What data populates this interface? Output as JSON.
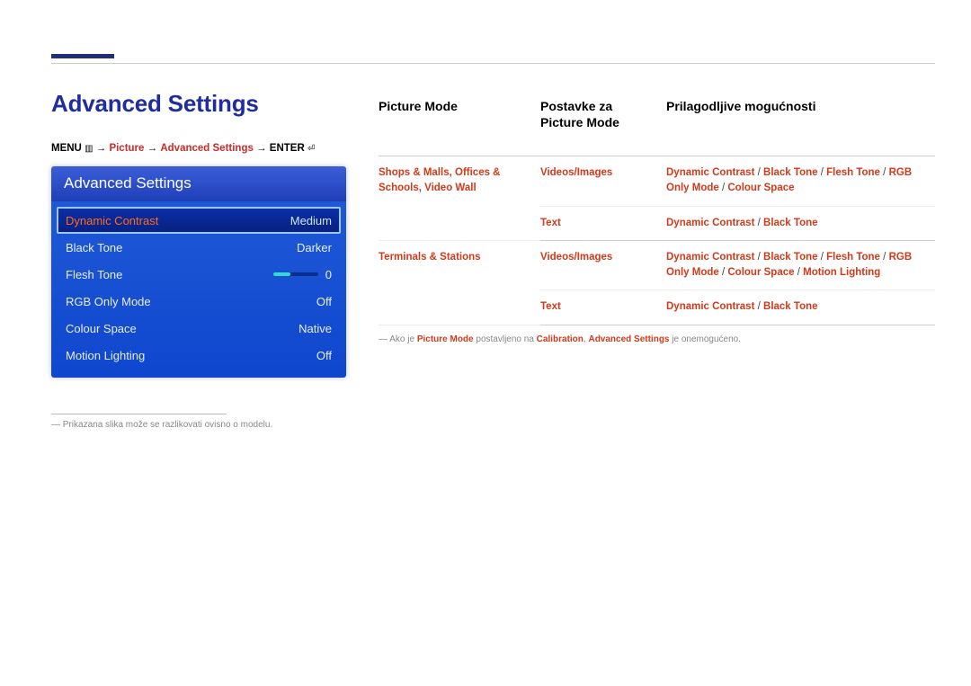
{
  "section_title": "Advanced Settings",
  "breadcrumb": {
    "menu": "MENU",
    "arrow": "→",
    "picture": "Picture",
    "advanced": "Advanced Settings",
    "enter": "ENTER"
  },
  "osd": {
    "title": "Advanced Settings",
    "rows": [
      {
        "label": "Dynamic Contrast",
        "value": "Medium",
        "selected": true
      },
      {
        "label": "Black Tone",
        "value": "Darker"
      },
      {
        "label": "Flesh Tone",
        "value": "0",
        "slider": true
      },
      {
        "label": "RGB Only Mode",
        "value": "Off"
      },
      {
        "label": "Colour Space",
        "value": "Native"
      },
      {
        "label": "Motion Lighting",
        "value": "Off"
      }
    ]
  },
  "footnote": "Prikazana slika može se razlikovati ovisno o modelu.",
  "table": {
    "headers": {
      "h1": "Picture Mode",
      "h2": "Postavke za Picture Mode",
      "h3": "Prilagodljive mogućnosti"
    },
    "group1": {
      "mode": [
        "Shops & Malls",
        "Offices & Schools",
        "Video Wall"
      ],
      "row1": {
        "sub": "Videos/Images",
        "opts": [
          "Dynamic Contrast",
          "Black Tone",
          "Flesh Tone",
          "RGB Only Mode",
          "Colour Space"
        ]
      },
      "row2": {
        "sub": "Text",
        "opts": [
          "Dynamic Contrast",
          "Black Tone"
        ]
      }
    },
    "group2": {
      "mode": [
        "Terminals & Stations"
      ],
      "row1": {
        "sub": "Videos/Images",
        "opts": [
          "Dynamic Contrast",
          "Black Tone",
          "Flesh Tone",
          "RGB Only Mode",
          "Colour Space",
          "Motion Lighting"
        ]
      },
      "row2": {
        "sub": "Text",
        "opts": [
          "Dynamic Contrast",
          "Black Tone"
        ]
      }
    }
  },
  "bottom_note": {
    "pre": "Ako je ",
    "a": "Picture Mode",
    "mid1": " postavljeno na ",
    "b": "Calibration",
    "mid2": ", ",
    "c": "Advanced Settings",
    "post": " je onemogućeno."
  }
}
